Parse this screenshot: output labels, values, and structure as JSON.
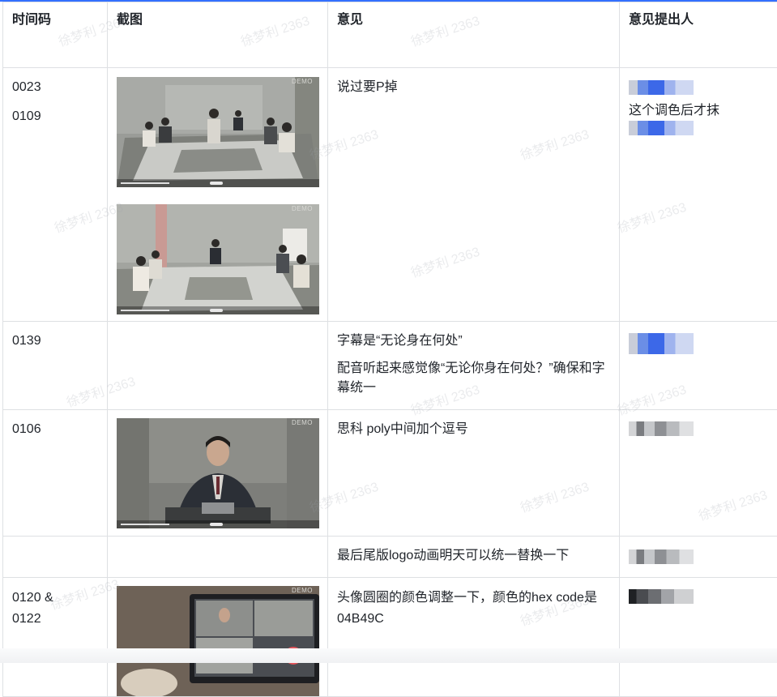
{
  "headers": {
    "timecode": "时间码",
    "screenshot": "截图",
    "comment": "意见",
    "reviewer": "意见提出人"
  },
  "rows": [
    {
      "timecodes": [
        "0023",
        "0109"
      ],
      "screenshots": [
        {
          "demo_label": "DEMO",
          "scene": "conference-room-wide"
        },
        {
          "demo_label": "DEMO",
          "scene": "conference-room-far"
        }
      ],
      "comments": [
        "说过要P掉"
      ],
      "reviewer_note": "这个调色后才抹"
    },
    {
      "timecodes": [
        "0139"
      ],
      "screenshots": [],
      "comments": [
        "字幕是“无论身在何处”",
        "配音听起来感觉像“无论你身在何处？”确保和字幕统一"
      ]
    },
    {
      "timecodes": [
        "0106"
      ],
      "screenshots": [
        {
          "demo_label": "DEMO",
          "scene": "presenter-at-desk"
        }
      ],
      "comments": [
        "思科 poly中间加个逗号"
      ]
    },
    {
      "timecodes": [
        ""
      ],
      "screenshots": [],
      "comments": [
        "最后尾版logo动画明天可以统一替换一下"
      ]
    },
    {
      "timecodes": [
        "0120 &",
        "0122"
      ],
      "screenshots": [
        {
          "demo_label": "DEMO",
          "scene": "laptop-video-call"
        }
      ],
      "comments": [
        "头像圆圈的颜色调整一下，颜色的hex code是 04B49C"
      ]
    }
  ],
  "watermark": "徐梦利 2363",
  "colors": {
    "accent_line": "#3370ff",
    "grid": "#dee0e3",
    "text": "#1f2329"
  }
}
